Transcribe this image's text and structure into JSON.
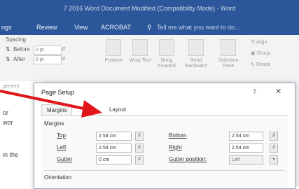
{
  "window": {
    "title": "7 2016 Word Document Modified (Compatibility Mode) - Word"
  },
  "ribbon_tabs": [
    {
      "label": "ngs"
    },
    {
      "label": "Review"
    },
    {
      "label": "View"
    },
    {
      "label": "ACROBAT"
    }
  ],
  "tell_me": {
    "placeholder": "Tell me what you want to do..."
  },
  "spacing": {
    "label": "Spacing",
    "before": {
      "label": "Before",
      "value": "0 pt"
    },
    "after": {
      "label": "After",
      "value": "0 pt"
    }
  },
  "ribbon_buttons": [
    {
      "label": "Position"
    },
    {
      "label": "Wrap Text"
    },
    {
      "label": "Bring Forward"
    },
    {
      "label": "Send Backward"
    },
    {
      "label": "Selection Pane"
    }
  ],
  "ribbon_small": {
    "align": "Align",
    "group": "Group",
    "rotate": "Rotate"
  },
  "document": {
    "lines": [
      "gement",
      "or",
      "wor",
      "in the"
    ]
  },
  "dialog": {
    "title": "Page Setup",
    "help": "?",
    "close": "✕",
    "tabs": [
      {
        "label": "Margins"
      },
      {
        "label": "Layout"
      }
    ],
    "margins_label": "Margins",
    "fields": {
      "top": {
        "label": "Top",
        "value": "2.54 cm"
      },
      "bottom": {
        "label": "Bottom",
        "value": "2.54 cm"
      },
      "left": {
        "label": "Left",
        "value": "2.54 cm"
      },
      "right": {
        "label": "Right",
        "value": "2.54 cm"
      },
      "gutter": {
        "label": "Gutter",
        "value": "0 cm"
      },
      "gutter_position": {
        "label": "Gutter position:",
        "value": "Left"
      }
    },
    "orientation_label": "Orientation"
  },
  "annotation": {
    "arrow_color": "#e0161b"
  }
}
